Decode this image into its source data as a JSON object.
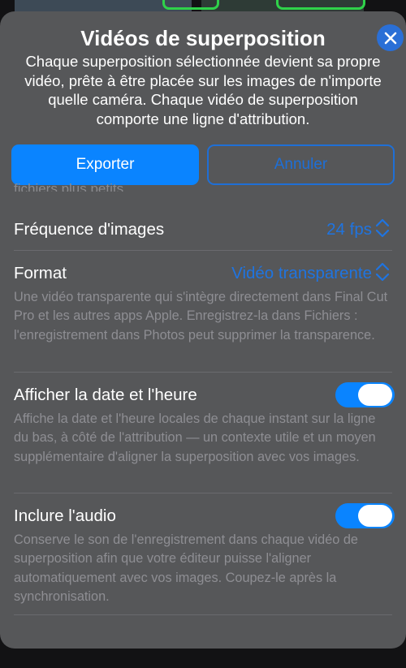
{
  "sheet": {
    "title": "Vidéos de superposition",
    "subtitle": "Chaque superposition sélectionnée devient sa propre vidéo, prête à être placée sur les images de n'importe quelle caméra. Chaque vidéo de superposition comporte une ligne d'attribution.",
    "close_icon": "close-x-icon"
  },
  "actions": {
    "export_label": "Exporter",
    "cancel_label": "Annuler"
  },
  "settings": {
    "clipped_text": "fichiers plus petits.",
    "frame_rate": {
      "label": "Fréquence d'images",
      "value": "24 fps"
    },
    "format": {
      "label": "Format",
      "value": "Vidéo transparente",
      "description": "Une vidéo transparente qui s'intègre directement dans Final Cut Pro et les autres apps Apple. Enregistrez-la dans Fichiers : l'enregistrement dans Photos peut supprimer la transparence."
    },
    "show_datetime": {
      "label": "Afficher la date et l'heure",
      "enabled": true,
      "description": "Affiche la date et l'heure locales de chaque instant sur la ligne du bas, à côté de l'attribution — un contexte utile et un moyen supplémentaire d'aligner la superposition avec vos images."
    },
    "include_audio": {
      "label": "Inclure l'audio",
      "enabled": true,
      "description": "Conserve le son de l'enregistrement dans chaque vidéo de superposition afin que votre éditeur puisse l'aligner automatiquement avec vos images. Coupez-le après la synchronisation."
    }
  },
  "colors": {
    "accent": "#0a84ff",
    "sheet_background": "#565759",
    "secondary_text": "#8e8e93"
  }
}
